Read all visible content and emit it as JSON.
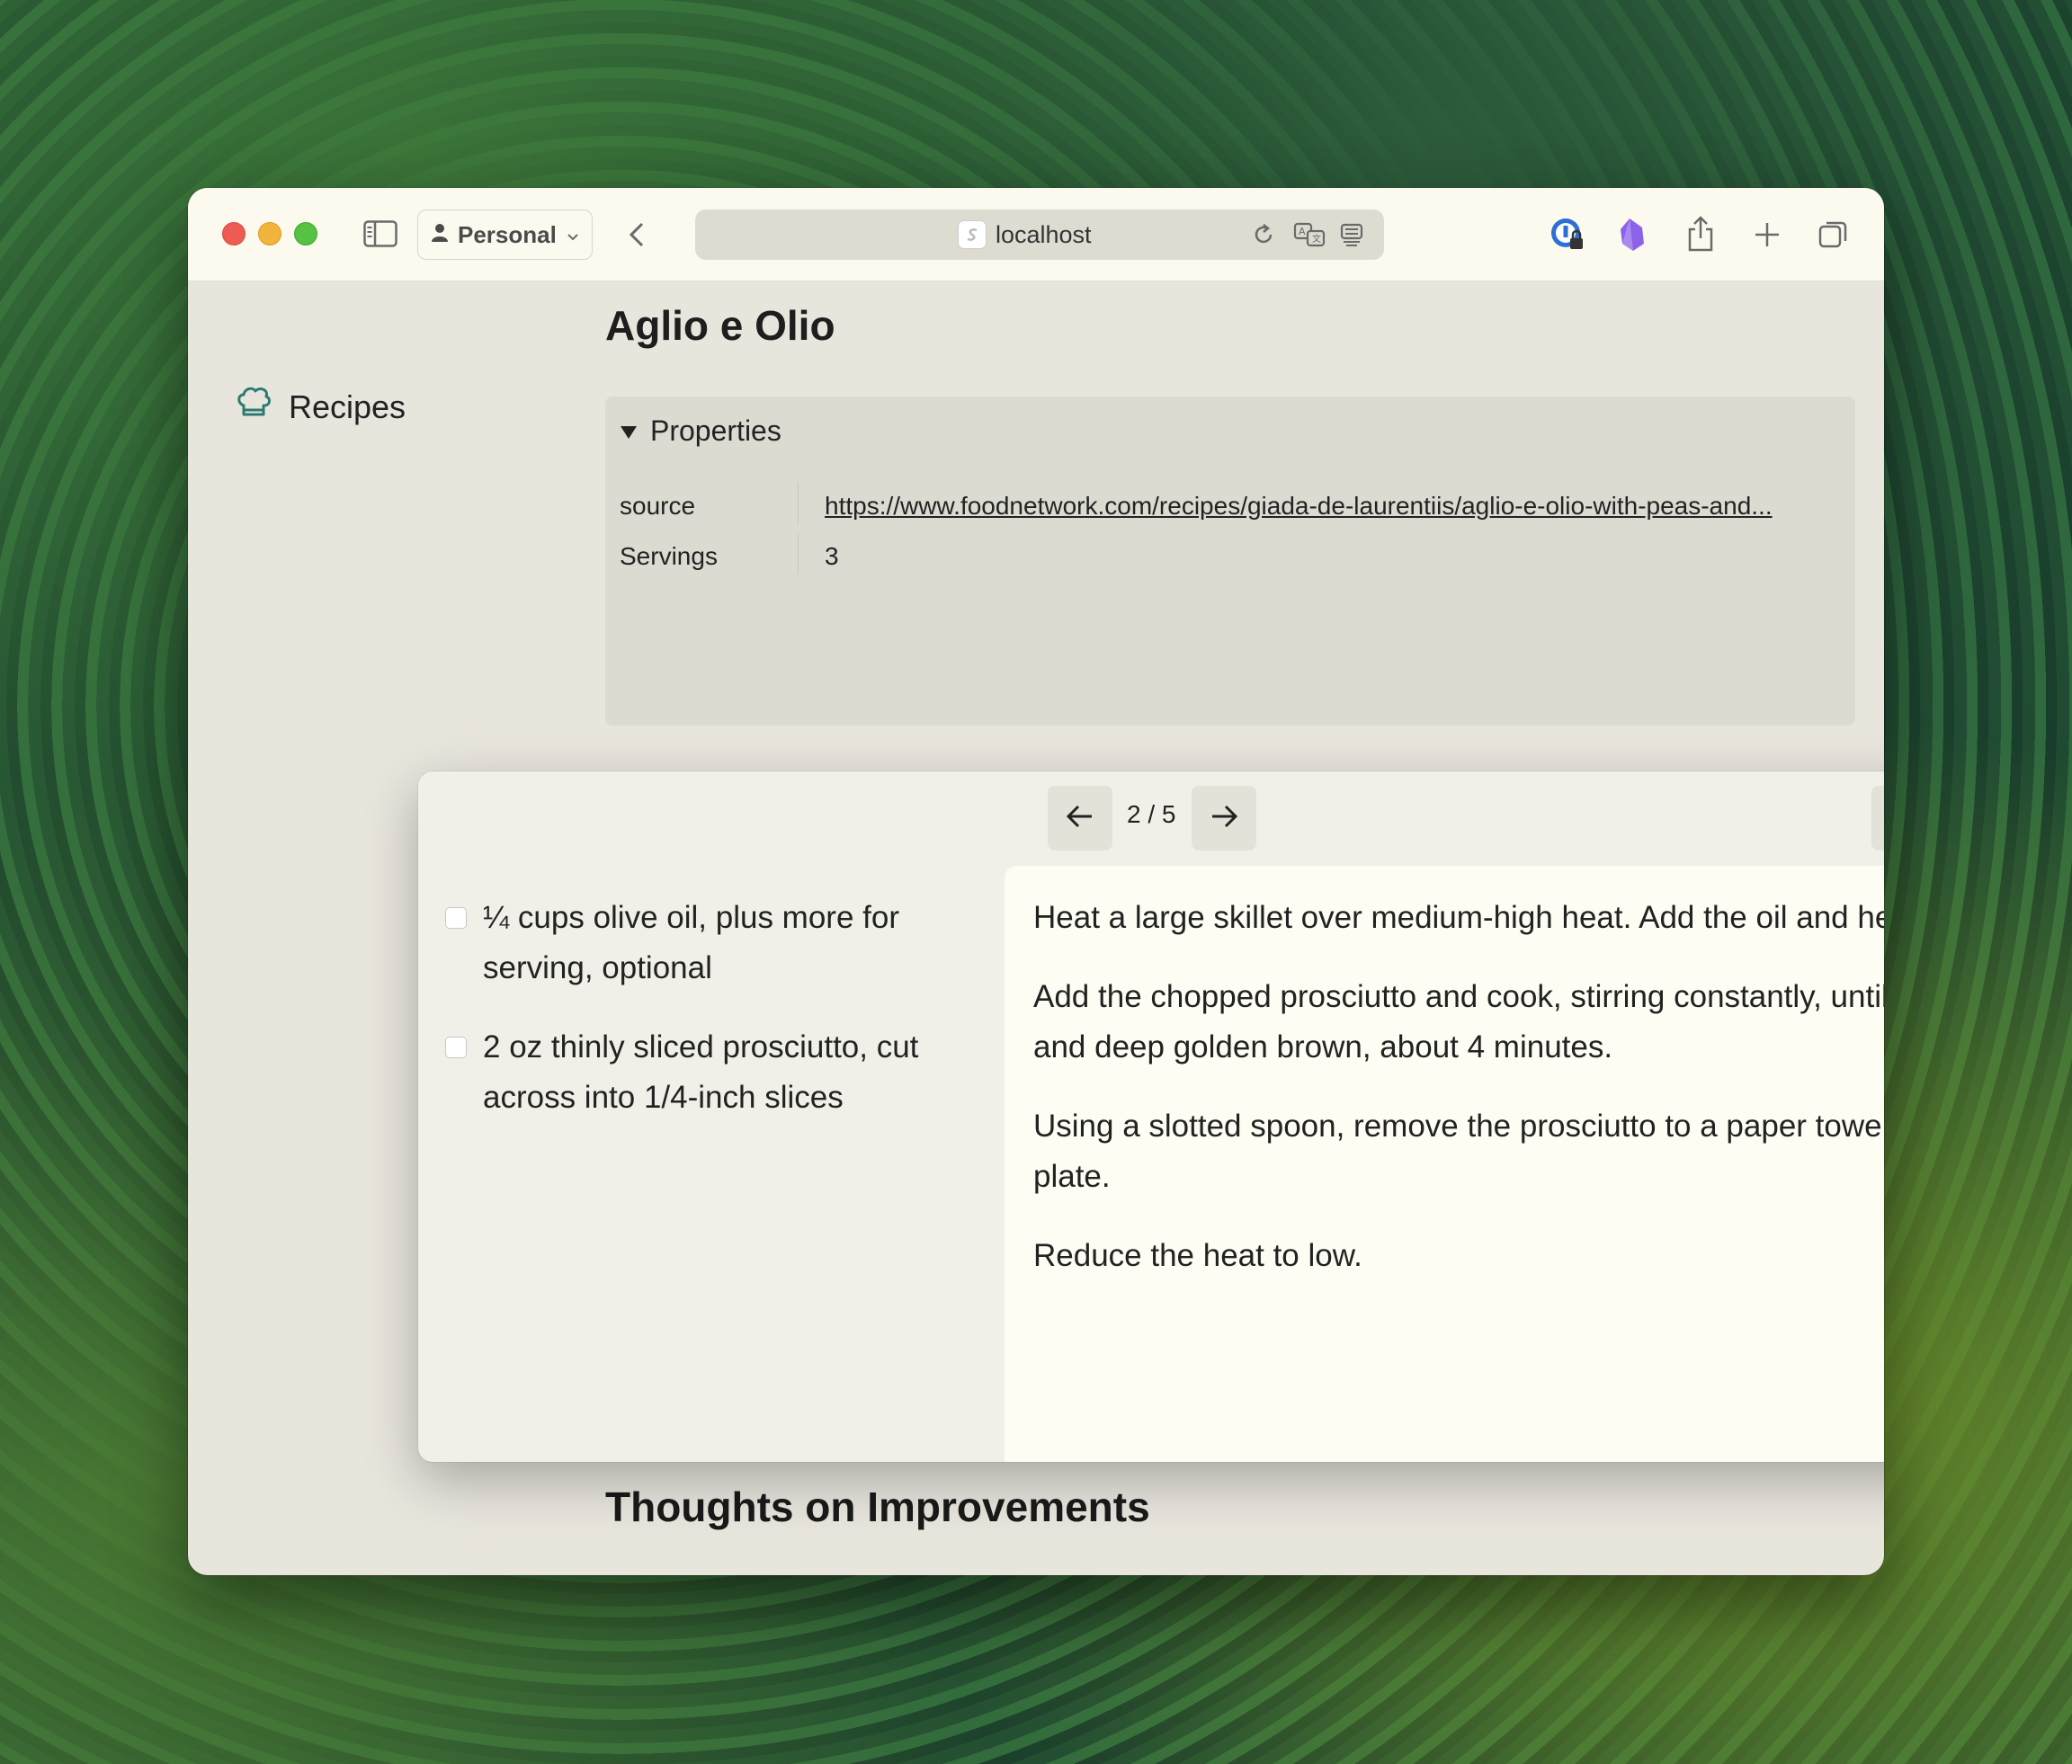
{
  "browser": {
    "profile_label": "Personal",
    "url": "localhost"
  },
  "sidebar": {
    "recipes_label": "Recipes"
  },
  "page": {
    "title": "Aglio e Olio",
    "properties_label": "Properties",
    "properties": [
      {
        "key": "source",
        "value": "https://www.foodnetwork.com/recipes/giada-de-laurentiis/aglio-e-olio-with-peas-and..."
      },
      {
        "key": "Servings",
        "value": "3"
      }
    ],
    "section_heading": "Thoughts on Improvements"
  },
  "overlay": {
    "counter": "2 / 5",
    "ingredients": [
      "¼ cups olive oil, plus more for serving, optional",
      "2 oz thinly sliced prosciutto, cut across into 1/4-inch slices"
    ],
    "steps": [
      "Heat a large skillet over medium-high heat. Add the oil and heat.",
      "Add the chopped prosciutto and cook, stirring constantly, until crispy and deep golden brown, about 4 minutes.",
      "Using a slotted spoon, remove the prosciutto to a paper towel-lined plate.",
      "Reduce the heat to low."
    ]
  }
}
